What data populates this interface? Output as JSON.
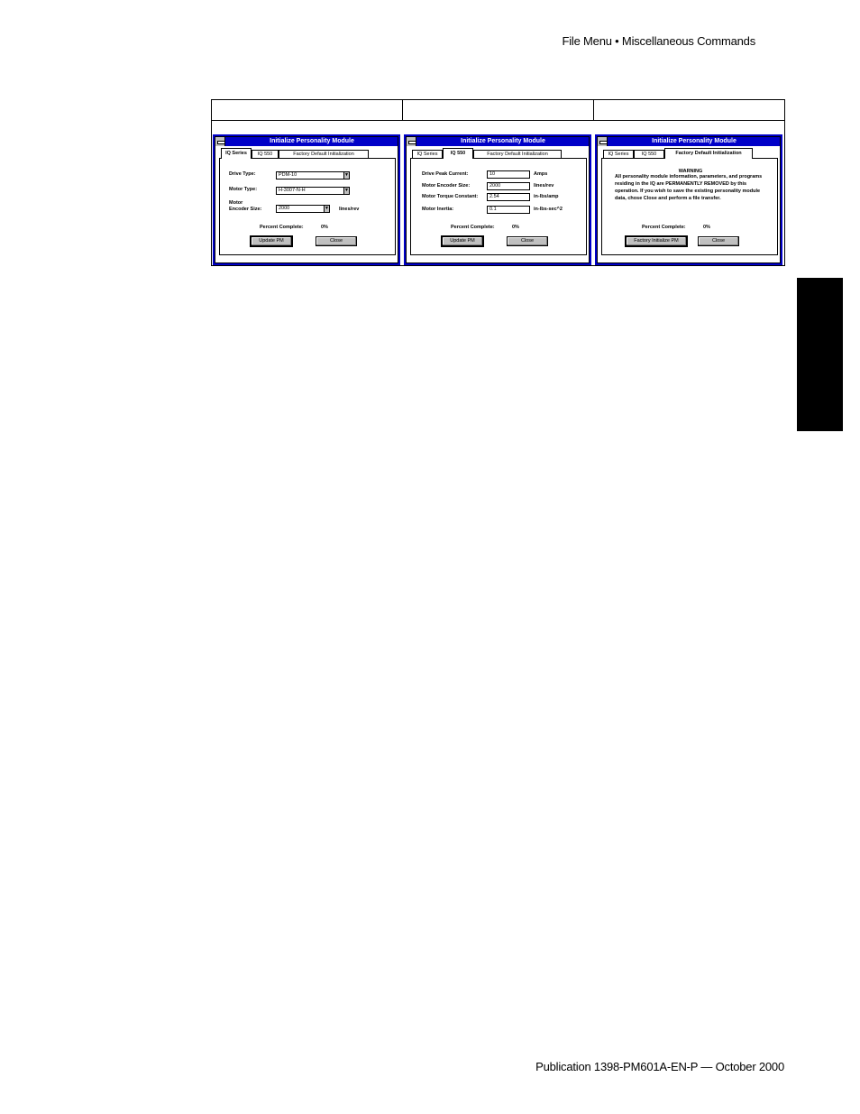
{
  "header": {
    "running_head": "File Menu • Miscellaneous Commands"
  },
  "footer": {
    "publication": "Publication 1398-PM601A-EN-P — October 2000"
  },
  "figure": {
    "column_labels": [
      "",
      "",
      ""
    ],
    "dialogs": [
      {
        "title": "Initialize Personality Module",
        "tabs": [
          "IQ Series",
          "IQ 550",
          "Factory Default Initialization"
        ],
        "active_tab": 0,
        "fields": {
          "drive_type_label": "Drive Type:",
          "drive_type_value": "PDM-10",
          "motor_type_label": "Motor Type:",
          "motor_type_value": "H-3007-N-H",
          "encoder_label_1": "Motor",
          "encoder_label_2": "Encoder Size:",
          "encoder_value": "2000",
          "encoder_unit": "lines/rev"
        },
        "percent_label": "Percent Complete:",
        "percent_value": "0%",
        "primary_button": "Update PM",
        "close_button": "Close"
      },
      {
        "title": "Initialize Personality Module",
        "tabs": [
          "IQ Series",
          "IQ 550",
          "Factory Default Initialization"
        ],
        "active_tab": 1,
        "fields": {
          "peak_current_label": "Drive Peak Current:",
          "peak_current_value": "10",
          "peak_current_unit": "Amps",
          "encoder_label": "Motor Encoder Size:",
          "encoder_value": "2000",
          "encoder_unit": "lines/rev",
          "torque_label": "Motor Torque Constant:",
          "torque_value": "2.54",
          "torque_unit": "in-lbs/amp",
          "inertia_label": "Motor Inertia:",
          "inertia_value": "0.1",
          "inertia_unit": "in-lbs-sec^2"
        },
        "percent_label": "Percent Complete:",
        "percent_value": "0%",
        "primary_button": "Update PM",
        "close_button": "Close"
      },
      {
        "title": "Initialize Personality Module",
        "tabs": [
          "IQ Series",
          "IQ 550",
          "Factory Default Initialization"
        ],
        "active_tab": 2,
        "warning_title": "WARNING",
        "warning_text": "All personality module information, parameters, and programs residing in the IQ are PERMANENTLY REMOVED by this operation. If you wish to save the existing personality module data, chose Close and perform a file transfer.",
        "percent_label": "Percent Complete:",
        "percent_value": "0%",
        "primary_button": "Factory Initialize PM",
        "close_button": "Close"
      }
    ]
  },
  "colors": {
    "title_bar": "#0000c8",
    "side_tab": "#000000"
  }
}
